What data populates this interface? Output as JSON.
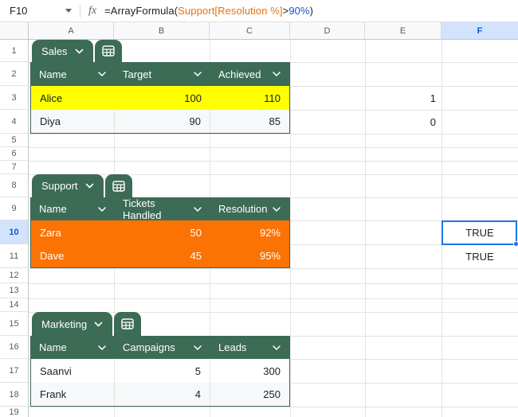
{
  "formula_bar": {
    "cell_ref": "F10",
    "fx_label": "fx",
    "formula": {
      "prefix": "=ArrayFormula(",
      "reference": "Support[Resolution %]",
      "operator": ">",
      "value": "90%",
      "suffix": ")"
    }
  },
  "grid": {
    "column_headers": [
      "A",
      "B",
      "C",
      "D",
      "E",
      "F"
    ],
    "selected_column": "F",
    "row_headers": [
      "1",
      "2",
      "3",
      "4",
      "5",
      "6",
      "7",
      "8",
      "9",
      "10",
      "11",
      "12",
      "13",
      "14",
      "15",
      "16",
      "17",
      "18",
      "19"
    ],
    "selected_row": "10"
  },
  "tables": {
    "sales": {
      "name": "Sales",
      "columns": [
        "Name",
        "Target",
        "Achieved"
      ],
      "rows": [
        [
          "Alice",
          "100",
          "110"
        ],
        [
          "Diya",
          "90",
          "85"
        ]
      ]
    },
    "support": {
      "name": "Support",
      "columns": [
        "Name",
        "Tickets Handled",
        "Resolution"
      ],
      "rows": [
        [
          "Zara",
          "50",
          "92%"
        ],
        [
          "Dave",
          "45",
          "95%"
        ]
      ]
    },
    "marketing": {
      "name": "Marketing",
      "columns": [
        "Name",
        "Campaigns",
        "Leads"
      ],
      "rows": [
        [
          "Saanvi",
          "5",
          "300"
        ],
        [
          "Frank",
          "4",
          "250"
        ]
      ]
    }
  },
  "cells": {
    "e3": "1",
    "e4": "0",
    "f10": "TRUE",
    "f11": "TRUE"
  },
  "colors": {
    "table_green": "#3c6b56",
    "row_orange": "#fb7305",
    "row_yellow": "#ffff00",
    "selection_blue": "#1a73e8",
    "formula_reference_orange": "#e8710a",
    "formula_value_blue": "#1155cc",
    "selected_header_bg": "#d3e3fd"
  }
}
